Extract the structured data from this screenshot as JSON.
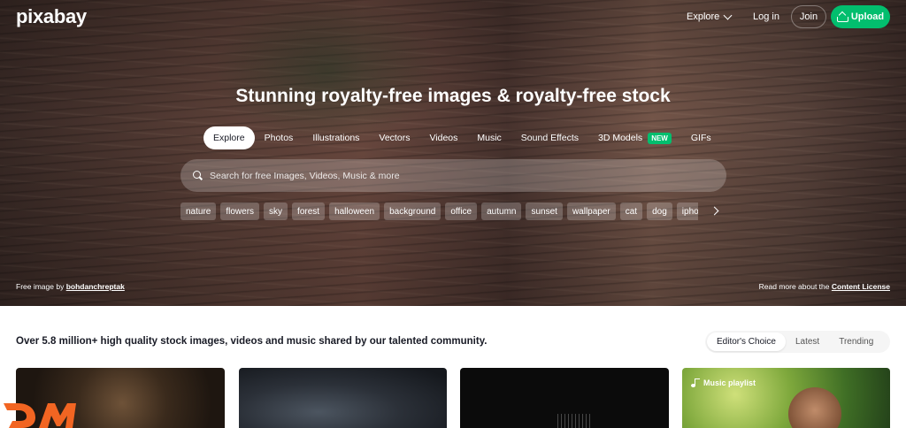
{
  "header": {
    "logo": "pixabay",
    "explore_label": "Explore",
    "login_label": "Log in",
    "join_label": "Join",
    "upload_label": "Upload"
  },
  "hero": {
    "title": "Stunning royalty-free images & royalty-free stock",
    "tabs": [
      {
        "label": "Explore",
        "active": true
      },
      {
        "label": "Photos"
      },
      {
        "label": "Illustrations"
      },
      {
        "label": "Vectors"
      },
      {
        "label": "Videos"
      },
      {
        "label": "Music"
      },
      {
        "label": "Sound Effects"
      },
      {
        "label": "3D Models",
        "badge": "NEW"
      },
      {
        "label": "GIFs"
      }
    ],
    "search_placeholder": "Search for free Images, Videos, Music & more",
    "chips": [
      "nature",
      "flowers",
      "sky",
      "forest",
      "halloween",
      "background",
      "office",
      "autumn",
      "sunset",
      "wallpaper",
      "cat",
      "dog",
      "iphone"
    ],
    "credit_prefix": "Free image by ",
    "credit_author": "bohdanchreptak",
    "license_prefix": "Read more about the ",
    "license_link": "Content License"
  },
  "main": {
    "tagline": "Over 5.8 million+ high quality stock images, videos and music shared by our talented community.",
    "sort_options": [
      {
        "label": "Editor's Choice",
        "active": true
      },
      {
        "label": "Latest"
      },
      {
        "label": "Trending"
      }
    ],
    "cards": [
      {
        "badge": ""
      },
      {
        "badge": ""
      },
      {
        "badge": ""
      },
      {
        "badge": "Music playlist"
      }
    ]
  },
  "colors": {
    "accent": "#02be6e",
    "text": "#191b26",
    "watermark": "#f26522"
  },
  "icons": [
    "chevron-down-icon",
    "upload-icon",
    "search-icon",
    "chevron-right-icon",
    "music-note-icon"
  ]
}
